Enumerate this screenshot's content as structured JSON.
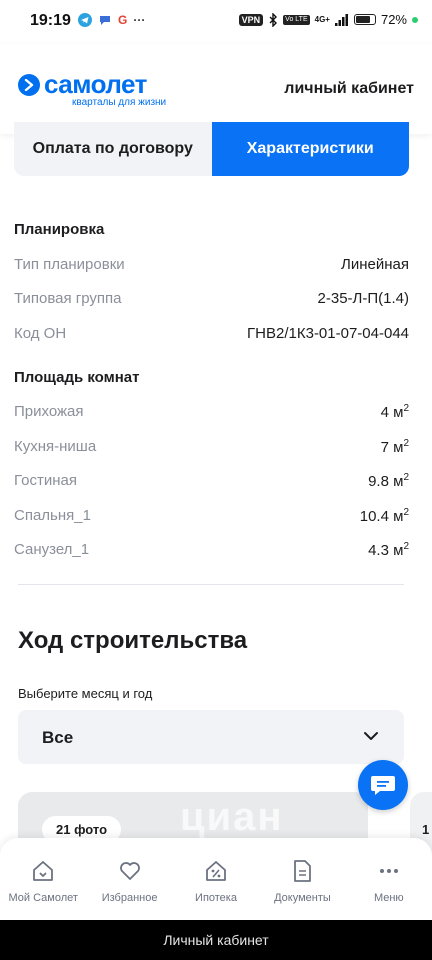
{
  "status_bar": {
    "time": "19:19",
    "vpn": "VPN",
    "network": "4G+",
    "battery": "72%",
    "more": "···",
    "google": "G",
    "volte": "Vo LTE"
  },
  "header": {
    "logo_name": "самолет",
    "logo_tagline": "кварталы для жизни",
    "cabinet_link": "личный кабинет"
  },
  "tabs": [
    {
      "label": "Оплата по договору",
      "active": false
    },
    {
      "label": "Характеристики",
      "active": true
    }
  ],
  "layout_section": {
    "title": "Планировка",
    "rows": [
      {
        "label": "Тип планировки",
        "value": "Линейная"
      },
      {
        "label": "Типовая группа",
        "value": "2-35-Л-П(1.4)"
      },
      {
        "label": "Код ОН",
        "value": "ГНВ2/1К3-01-07-04-044"
      }
    ]
  },
  "rooms_section": {
    "title": "Площадь комнат",
    "unit": "м",
    "unit_power": "2",
    "rows": [
      {
        "label": "Прихожая",
        "value": "4"
      },
      {
        "label": "Кухня-ниша",
        "value": "7"
      },
      {
        "label": "Гостиная",
        "value": "9.8"
      },
      {
        "label": "Спальня_1",
        "value": "10.4"
      },
      {
        "label": "Санузел_1",
        "value": "4.3"
      }
    ]
  },
  "construction": {
    "title": "Ход строительства",
    "select_label": "Выберите месяц и год",
    "select_value": "Все",
    "photo_count": "21 фото",
    "next_card_partial": "1",
    "watermark": "циан"
  },
  "bottom_nav": [
    {
      "label": "Мой Самолет",
      "icon": "home-icon"
    },
    {
      "label": "Избранное",
      "icon": "heart-icon"
    },
    {
      "label": "Ипотека",
      "icon": "mortgage-icon"
    },
    {
      "label": "Документы",
      "icon": "document-icon"
    },
    {
      "label": "Меню",
      "icon": "more-icon"
    }
  ],
  "browser_bar": {
    "title": "Личный кабинет"
  },
  "colors": {
    "brand": "#0070f0",
    "accent": "#0a72f5",
    "muted_text": "#8a8f99",
    "surface": "#f2f3f7"
  }
}
